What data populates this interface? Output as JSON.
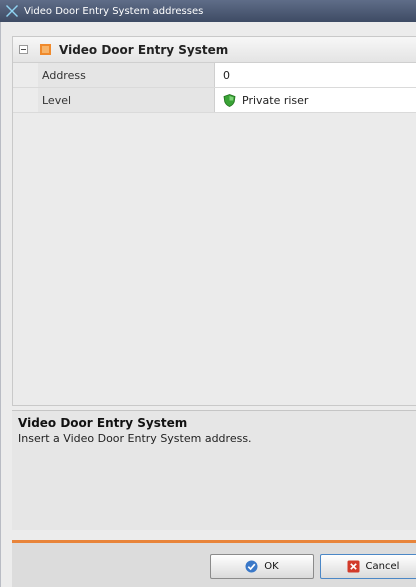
{
  "window": {
    "title": "Video Door Entry System addresses"
  },
  "group": {
    "title": "Video Door Entry System"
  },
  "properties": [
    {
      "label": "Address",
      "value": "0"
    },
    {
      "label": "Level",
      "value": "Private riser",
      "icon": "shield-icon"
    }
  ],
  "description": {
    "title": "Video Door Entry System",
    "text": "Insert a Video Door Entry System address."
  },
  "buttons": {
    "ok_label": "OK",
    "cancel_label": "Cancel"
  },
  "colors": {
    "titlebar": "#4e5b77",
    "accent_line": "#e8843a",
    "shield": "#3aa336",
    "cancel_icon": "#d23a2a",
    "ok_icon": "#3a78c8"
  }
}
